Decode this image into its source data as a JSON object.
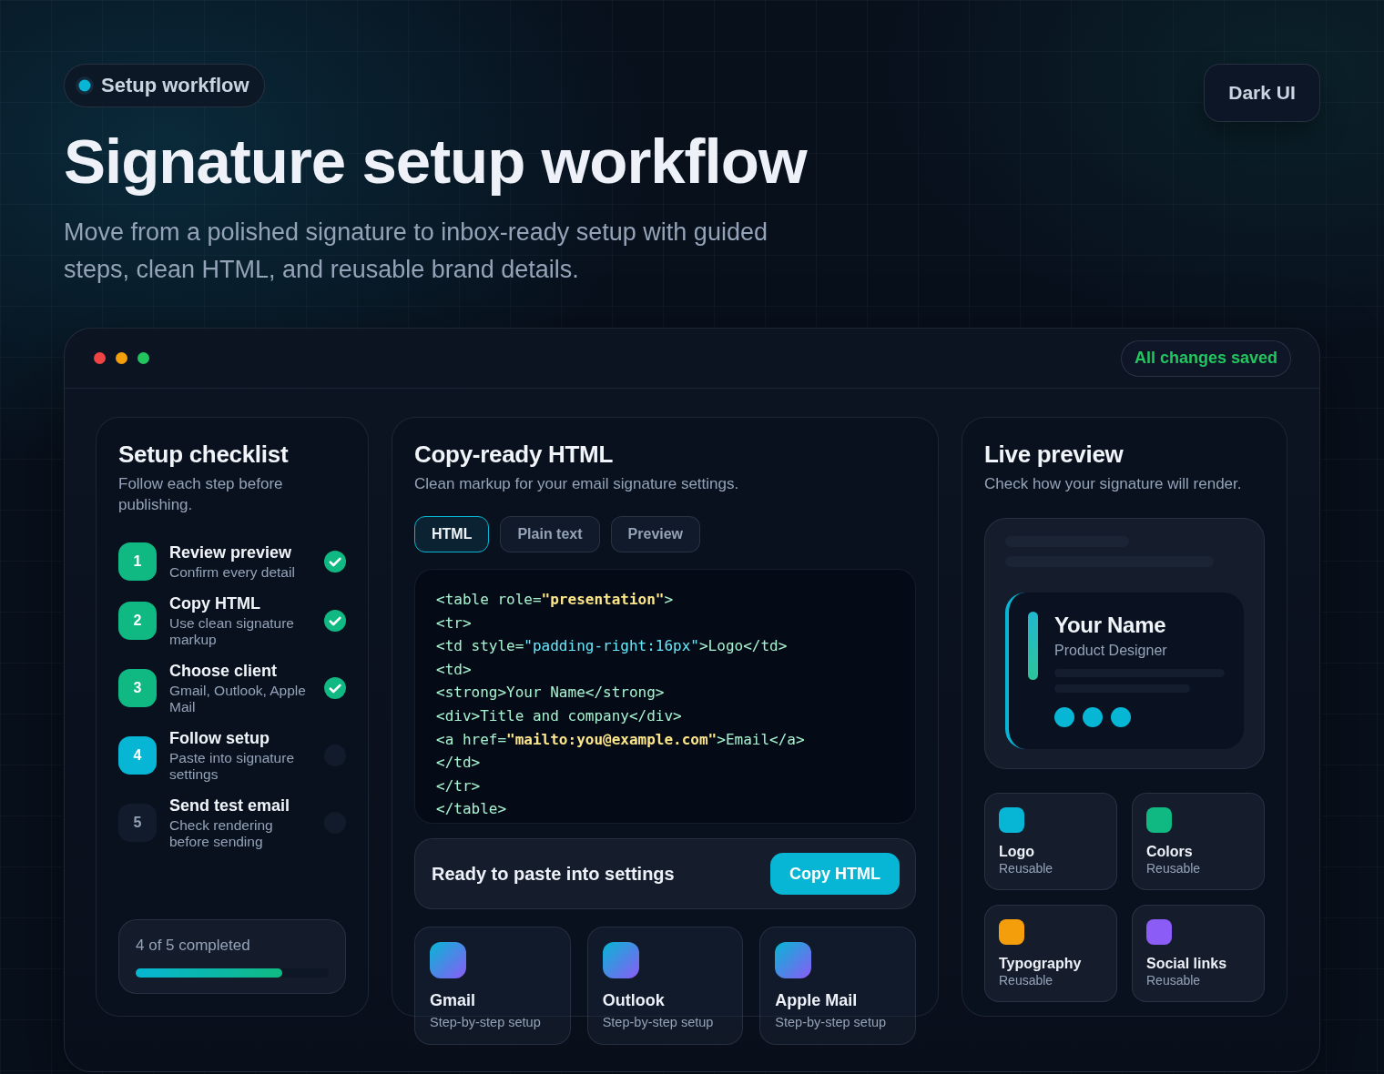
{
  "header": {
    "badge": "Setup workflow",
    "theme_button": "Dark UI",
    "title": "Signature setup workflow",
    "subtitle": "Move from a polished signature to inbox-ready setup with guided steps, clean HTML, and reusable brand details."
  },
  "window": {
    "controls": [
      {
        "color": "#ef4444"
      },
      {
        "color": "#f59e0b"
      },
      {
        "color": "#22c55e"
      }
    ],
    "status": "All changes saved"
  },
  "checklist": {
    "title": "Setup checklist",
    "subtitle": "Follow each step before publishing.",
    "steps": [
      {
        "number": "1",
        "title": "Review preview",
        "description": "Confirm every detail",
        "checked": true,
        "current": false
      },
      {
        "number": "2",
        "title": "Copy HTML",
        "description": "Use clean signature markup",
        "checked": true,
        "current": false
      },
      {
        "number": "3",
        "title": "Choose client",
        "description": "Gmail, Outlook, Apple Mail",
        "checked": true,
        "current": false
      },
      {
        "number": "4",
        "title": "Follow setup",
        "description": "Paste into signature settings",
        "checked": false,
        "current": true
      },
      {
        "number": "5",
        "title": "Send test email",
        "description": "Check rendering before sending",
        "checked": false,
        "current": false
      }
    ],
    "progress": {
      "label": "4 of 5 completed",
      "level": 0.76
    }
  },
  "html_panel": {
    "title": "Copy-ready HTML",
    "subtitle": "Clean markup for your email signature settings.",
    "tabs": [
      {
        "label": "HTML",
        "selected": true
      },
      {
        "label": "Plain text",
        "selected": false
      },
      {
        "label": "Preview",
        "selected": false
      }
    ],
    "code": [
      [
        {
          "text": "<table role=",
          "kind": "markup"
        },
        {
          "text": "\"presentation\"",
          "kind": "string"
        },
        {
          "text": ">",
          "kind": "markup"
        }
      ],
      [
        {
          "text": "<tr>",
          "kind": "markup"
        }
      ],
      [
        {
          "text": "<td style=",
          "kind": "markup"
        },
        {
          "text": "\"padding-right:16px\"",
          "kind": "value"
        },
        {
          "text": ">Logo</td>",
          "kind": "markup"
        }
      ],
      [
        {
          "text": "<td>",
          "kind": "markup"
        }
      ],
      [
        {
          "text": "<strong>Your Name</strong>",
          "kind": "markup"
        }
      ],
      [
        {
          "text": "<div>Title and company</div>",
          "kind": "markup"
        }
      ],
      [
        {
          "text": "<a href=",
          "kind": "markup"
        },
        {
          "text": "\"mailto:you@example.com\"",
          "kind": "string"
        },
        {
          "text": ">Email</a>",
          "kind": "markup"
        }
      ],
      [
        {
          "text": "</td>",
          "kind": "markup"
        }
      ],
      [
        {
          "text": "</tr>",
          "kind": "markup"
        }
      ],
      [
        {
          "text": "</table>",
          "kind": "markup"
        }
      ]
    ],
    "paste_bar": {
      "label": "Ready to paste into settings",
      "button": "Copy HTML"
    },
    "clients": [
      {
        "name": "Gmail",
        "description": "Step-by-step setup"
      },
      {
        "name": "Outlook",
        "description": "Step-by-step setup"
      },
      {
        "name": "Apple Mail",
        "description": "Step-by-step setup"
      }
    ]
  },
  "preview_panel": {
    "title": "Live preview",
    "subtitle": "Check how your signature will render.",
    "signature": {
      "name": "Your Name",
      "role": "Product Designer"
    },
    "assets": [
      {
        "name": "Logo",
        "description": "Reusable",
        "color": "#06b6d4"
      },
      {
        "name": "Colors",
        "description": "Reusable",
        "color": "#10b981"
      },
      {
        "name": "Typography",
        "description": "Reusable",
        "color": "#f59e0b"
      },
      {
        "name": "Social links",
        "description": "Reusable",
        "color": "#8b5cf6"
      }
    ]
  }
}
